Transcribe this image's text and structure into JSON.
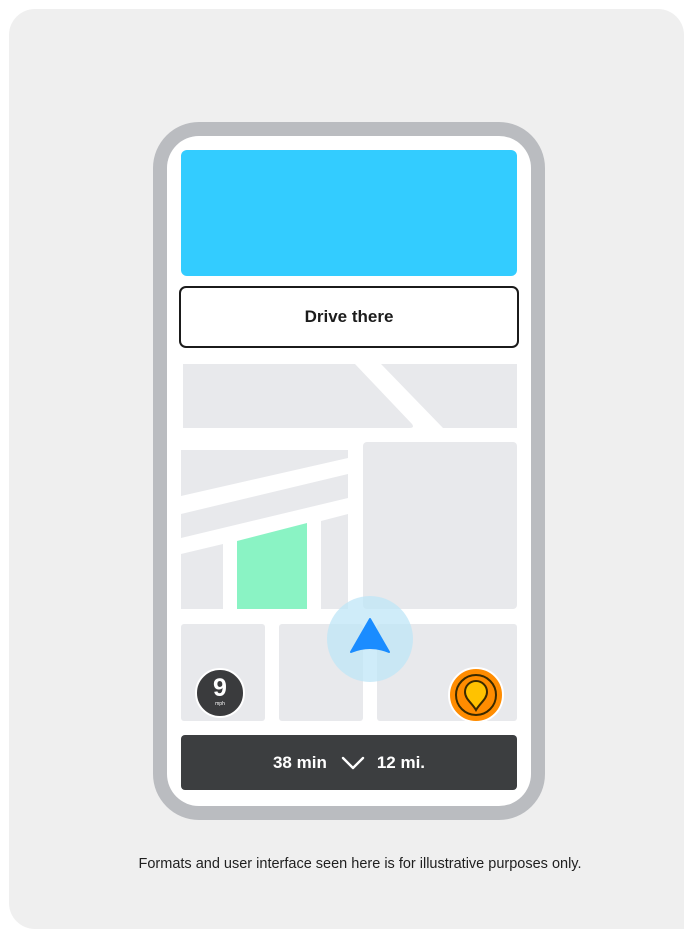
{
  "drive_button": {
    "label": "Drive there"
  },
  "trip": {
    "duration": "38 min",
    "distance": "12 mi."
  },
  "speed": {
    "value": "9",
    "unit": "mph"
  },
  "caption": "Formats and user interface seen here is for illustrative purposes only.",
  "icons": {
    "navigation": "navigation-arrow-icon",
    "destination": "location-pin-icon",
    "expand": "chevron-down-icon"
  },
  "colors": {
    "banner": "#33ccff",
    "park": "#8af3c4",
    "nav_arrow": "#1e90ff",
    "nav_halo": "#a9dff7",
    "pin": "#ff8c00",
    "pin_inner": "#ffc200",
    "bottom_bar": "#3c3e40"
  }
}
